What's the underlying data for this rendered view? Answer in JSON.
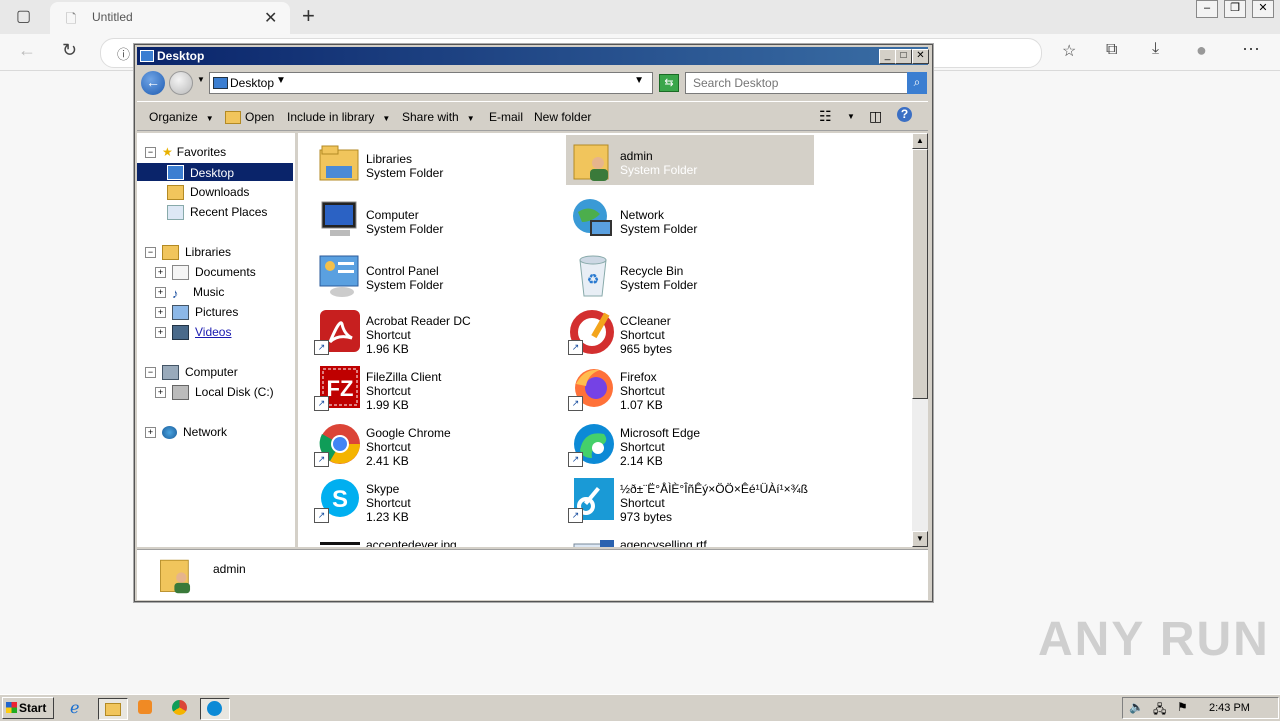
{
  "browser": {
    "tab_title": "Untitled",
    "new_tab_symbol": "+"
  },
  "explorer": {
    "window_title": "Desktop",
    "address": "Desktop",
    "search_placeholder": "Search Desktop",
    "commands": [
      "Organize",
      "Open",
      "Include in library",
      "Share with",
      "E-mail",
      "New folder"
    ],
    "nav_tree": {
      "favorites": {
        "label": "Favorites",
        "items": [
          "Desktop",
          "Downloads",
          "Recent Places"
        ]
      },
      "libraries": {
        "label": "Libraries",
        "items": [
          "Documents",
          "Music",
          "Pictures",
          "Videos"
        ]
      },
      "computer": {
        "label": "Computer",
        "items": [
          "Local Disk (C:)"
        ]
      },
      "network": {
        "label": "Network"
      }
    },
    "files": [
      {
        "name": "Libraries",
        "type": "System Folder",
        "size": "",
        "icon": "libraries-folder-icon",
        "shortcut": false
      },
      {
        "name": "admin",
        "type": "System Folder",
        "size": "",
        "icon": "user-folder-icon",
        "shortcut": false,
        "selected": true
      },
      {
        "name": "Computer",
        "type": "System Folder",
        "size": "",
        "icon": "computer-icon",
        "shortcut": false
      },
      {
        "name": "Network",
        "type": "System Folder",
        "size": "",
        "icon": "network-globe-icon",
        "shortcut": false
      },
      {
        "name": "Control Panel",
        "type": "System Folder",
        "size": "",
        "icon": "control-panel-icon",
        "shortcut": false
      },
      {
        "name": "Recycle Bin",
        "type": "System Folder",
        "size": "",
        "icon": "recycle-bin-icon",
        "shortcut": false
      },
      {
        "name": "Acrobat Reader DC",
        "type": "Shortcut",
        "size": "1.96 KB",
        "icon": "acrobat-icon",
        "shortcut": true
      },
      {
        "name": "CCleaner",
        "type": "Shortcut",
        "size": "965 bytes",
        "icon": "ccleaner-icon",
        "shortcut": true
      },
      {
        "name": "FileZilla Client",
        "type": "Shortcut",
        "size": "1.99 KB",
        "icon": "filezilla-icon",
        "shortcut": true
      },
      {
        "name": "Firefox",
        "type": "Shortcut",
        "size": "1.07 KB",
        "icon": "firefox-icon",
        "shortcut": true
      },
      {
        "name": "Google Chrome",
        "type": "Shortcut",
        "size": "2.41 KB",
        "icon": "chrome-icon",
        "shortcut": true
      },
      {
        "name": "Microsoft Edge",
        "type": "Shortcut",
        "size": "2.14 KB",
        "icon": "edge-icon",
        "shortcut": true
      },
      {
        "name": "Skype",
        "type": "Shortcut",
        "size": "1.23 KB",
        "icon": "skype-icon",
        "shortcut": true
      },
      {
        "name": "½ð±¨Ë°ÅÌÈ°ÎñÊý×ÖÖ×Êé¹ÜÀí¹×¾ß",
        "type": "Shortcut",
        "size": "973 bytes",
        "icon": "key-app-icon",
        "shortcut": true
      },
      {
        "name": "accentedever.jpg",
        "type": "",
        "size": "",
        "icon": "image-file-icon",
        "shortcut": false
      },
      {
        "name": "agencyselling.rtf",
        "type": "",
        "size": "",
        "icon": "rtf-file-icon",
        "shortcut": false
      }
    ],
    "details": {
      "name": "admin"
    }
  },
  "watermark": "ANY RUN",
  "taskbar": {
    "start_label": "Start",
    "clock": "2:43 PM"
  },
  "colors": {
    "title_gradient_start": "#0a246a",
    "title_gradient_end": "#3a6ea5",
    "selection": "#0a246a",
    "window_face": "#d4d0c8"
  }
}
